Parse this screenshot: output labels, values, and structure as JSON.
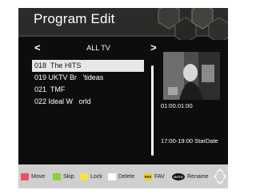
{
  "screen": {
    "title": "Program Edit",
    "group": "ALL  TV",
    "nav_left": "<",
    "nav_right": ">"
  },
  "channels": [
    {
      "label": "018  The HITS",
      "selected": true
    },
    {
      "label": "019 UKTV Br   'tideas",
      "selected": false
    },
    {
      "label": "021  TMF",
      "selected": false
    },
    {
      "label": "022 Ideal W   orld",
      "selected": false
    }
  ],
  "info": {
    "time": "01:00.01:00",
    "epg": "17:00-19:00  StarDate"
  },
  "help": {
    "move": "Move",
    "skip": "Skip",
    "lock": "Lock",
    "delete": "Delete",
    "fav_box": "FAV",
    "fav": "FAV",
    "goto_box": "GOTO",
    "rename": "Rename"
  },
  "colors": {
    "move": "#e8516a",
    "skip": "#8fcf3a",
    "lock": "#f2e34c",
    "delete": "#ffffff"
  }
}
